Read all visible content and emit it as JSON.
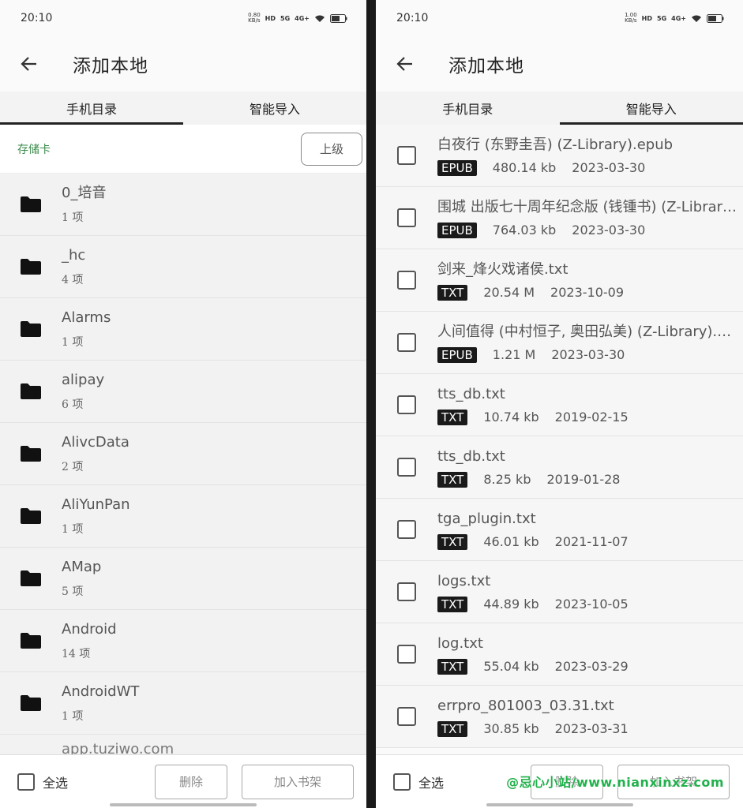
{
  "left": {
    "status": {
      "time": "20:10",
      "net_speed": "0.80\nKB/s",
      "hd": "HD",
      "sig1": "5G",
      "sig2": "4G+",
      "battery": "55"
    },
    "title": "添加本地",
    "tabs": [
      {
        "label": "手机目录",
        "active": true
      },
      {
        "label": "智能导入",
        "active": false
      }
    ],
    "path_label": "存储卡",
    "up_button": "上级",
    "folders": [
      {
        "name": "0_培音",
        "count": "1 项"
      },
      {
        "name": "_hc",
        "count": "4 项"
      },
      {
        "name": "Alarms",
        "count": "1 项"
      },
      {
        "name": "alipay",
        "count": "6 项"
      },
      {
        "name": "AlivcData",
        "count": "2 项"
      },
      {
        "name": "AliYunPan",
        "count": "1 项"
      },
      {
        "name": "AMap",
        "count": "5 项"
      },
      {
        "name": "Android",
        "count": "14 项"
      },
      {
        "name": "AndroidWT",
        "count": "1 项"
      }
    ],
    "partial_folder": "app.tuziwo.com",
    "bottom": {
      "select_all": "全选",
      "delete": "删除",
      "add_to_shelf": "加入书架"
    }
  },
  "right": {
    "status": {
      "time": "20:10",
      "net_speed": "1.00\nKB/s",
      "hd": "HD",
      "sig1": "5G",
      "sig2": "4G+",
      "battery": "55"
    },
    "title": "添加本地",
    "tabs": [
      {
        "label": "手机目录",
        "active": false
      },
      {
        "label": "智能导入",
        "active": true
      }
    ],
    "files": [
      {
        "name": "白夜行 (东野圭吾) (Z-Library).epub",
        "type": "EPUB",
        "size": "480.14 kb",
        "date": "2023-03-30"
      },
      {
        "name": "围城  出版七十周年纪念版 (钱锺书) (Z-Library).epub",
        "type": "EPUB",
        "size": "764.03 kb",
        "date": "2023-03-30"
      },
      {
        "name": "剑来_烽火戏诸侯.txt",
        "type": "TXT",
        "size": "20.54 M",
        "date": "2023-10-09"
      },
      {
        "name": "人间值得 (中村恒子, 奥田弘美) (Z-Library).epub",
        "type": "EPUB",
        "size": "1.21 M",
        "date": "2023-03-30"
      },
      {
        "name": "tts_db.txt",
        "type": "TXT",
        "size": "10.74 kb",
        "date": "2019-02-15"
      },
      {
        "name": "tts_db.txt",
        "type": "TXT",
        "size": "8.25 kb",
        "date": "2019-01-28"
      },
      {
        "name": "tga_plugin.txt",
        "type": "TXT",
        "size": "46.01 kb",
        "date": "2021-11-07"
      },
      {
        "name": "logs.txt",
        "type": "TXT",
        "size": "44.89 kb",
        "date": "2023-10-05"
      },
      {
        "name": "log.txt",
        "type": "TXT",
        "size": "55.04 kb",
        "date": "2023-03-29"
      },
      {
        "name": "errpro_801003_03.31.txt",
        "type": "TXT",
        "size": "30.85 kb",
        "date": "2023-03-31"
      }
    ],
    "bottom": {
      "select_all": "全选",
      "delete": "删除",
      "add_to_shelf": "加入书架"
    }
  },
  "watermark": "@忌心小站/www.nianxinxz.com"
}
